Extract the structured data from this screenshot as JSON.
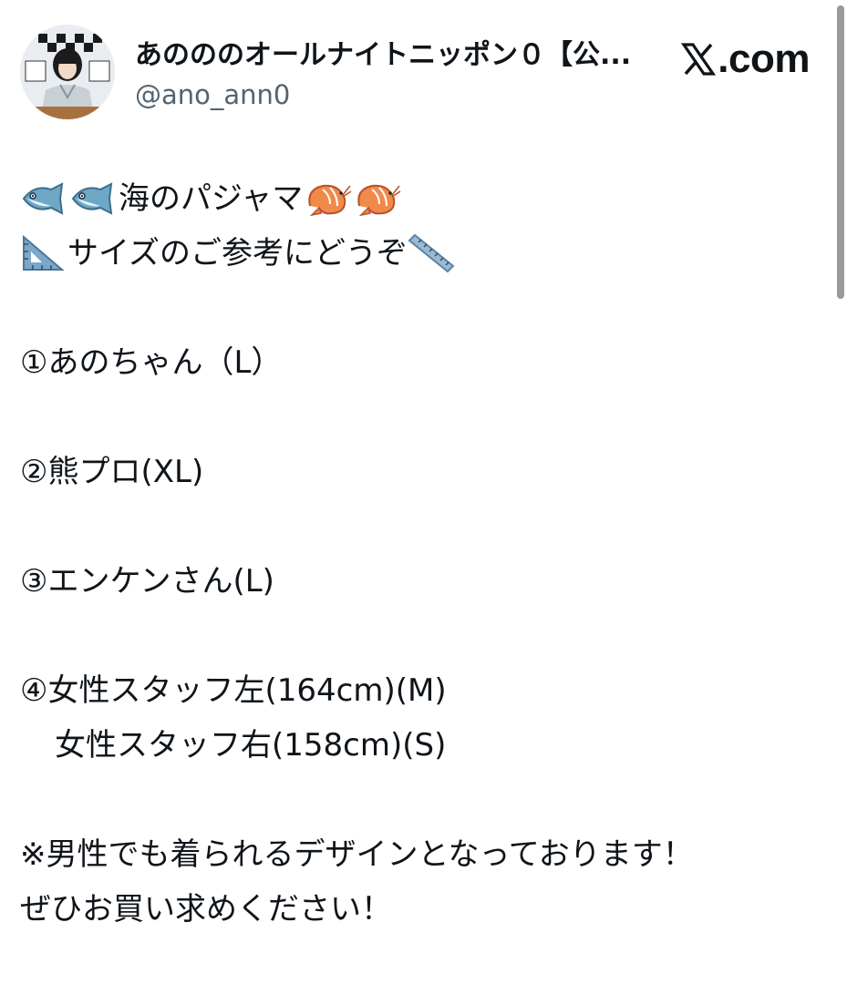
{
  "post": {
    "author": {
      "display_name": "あのののオールナイトニッポン０【公...",
      "handle": "@ano_ann0",
      "avatar_icon": "profile-photo"
    },
    "brand": {
      "label": ".com",
      "icon": "x-logo-icon"
    },
    "lines": {
      "title": "海のパジャマ",
      "subtitle": "サイズのご参考にどうぞ",
      "item1": "①あのちゃん（L）",
      "item2": "②熊プロ(XL)",
      "item3": "③エンケンさん(L)",
      "item4a": "④女性スタッフ左(164cm)(M)",
      "item4b": "女性スタッフ右(158cm)(S)",
      "note1": "※男性でも着られるデザインとなっております！",
      "note2": "ぜひお買い求めください！"
    },
    "emojis": {
      "fish": "fish-icon",
      "shrimp": "shrimp-icon",
      "triangle_ruler": "triangular-ruler-icon",
      "straight_ruler": "straight-ruler-icon"
    }
  },
  "colors": {
    "text_primary": "#0f1419",
    "text_secondary": "#536471",
    "background": "#ffffff"
  }
}
